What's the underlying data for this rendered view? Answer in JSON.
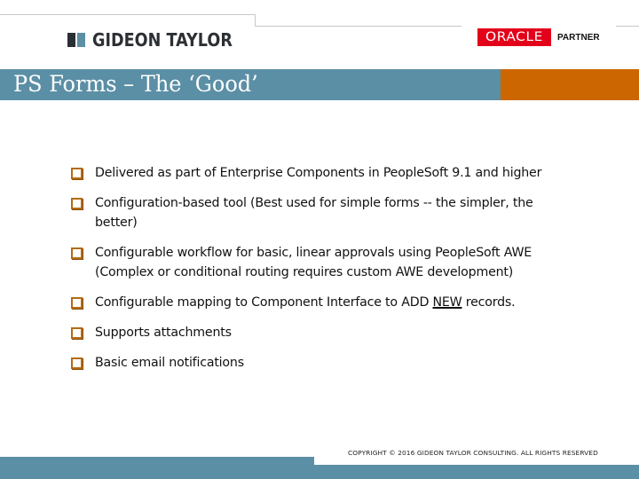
{
  "header": {
    "company_logo_text": "GIDEON TAYLOR",
    "partner_logo": {
      "brand": "ORACLE",
      "label": "PARTNER",
      "brand_color": "#e3001b"
    }
  },
  "slide": {
    "title": "PS Forms – The ‘Good’",
    "title_bar_color": "#5b8fa5",
    "accent_color": "#cc6600",
    "bullet_icon": "checkbox-square-icon",
    "bullets": [
      {
        "text": "Delivered as part of Enterprise Components in PeopleSoft 9.1 and higher"
      },
      {
        "text": "Configuration-based tool (Best used for simple forms -- the simpler, the better)"
      },
      {
        "text": "Configurable workflow for basic, linear approvals using PeopleSoft AWE (Complex or conditional routing requires custom AWE development)"
      },
      {
        "pre": "Configurable mapping to Component Interface to ADD ",
        "emphasis": "NEW",
        "post": " records."
      },
      {
        "text": "Supports attachments"
      },
      {
        "text": "Basic email notifications"
      }
    ]
  },
  "footer": {
    "copyright": "COPYRIGHT © 2016 GIDEON TAYLOR CONSULTING. ALL RIGHTS RESERVED"
  }
}
